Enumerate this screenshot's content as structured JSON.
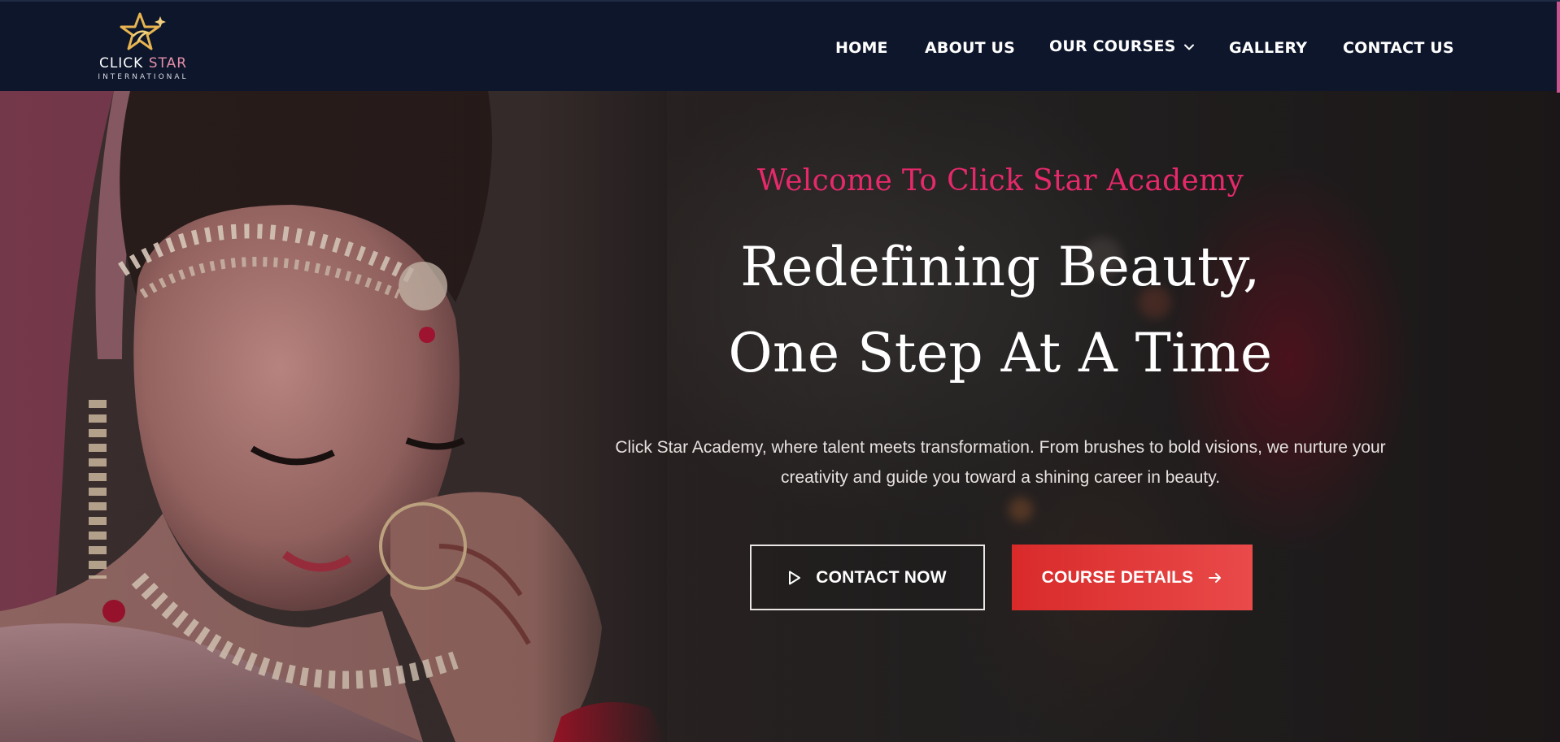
{
  "brand": {
    "name_part1": "CLICK",
    "name_part2": "STAR",
    "subtitle": "INTERNATIONAL",
    "icon": "star-logo-icon",
    "accent_color": "#e58fa9"
  },
  "nav": {
    "items": [
      {
        "label": "HOME"
      },
      {
        "label": "ABOUT US"
      },
      {
        "label": "OUR COURSES",
        "has_dropdown": true,
        "icon": "chevron-down-icon"
      },
      {
        "label": "GALLERY"
      },
      {
        "label": "CONTACT US"
      }
    ]
  },
  "hero": {
    "eyebrow": "Welcome To Click Star Academy",
    "headline_line1": "Redefining Beauty,",
    "headline_line2": "One Step At A Time",
    "description": "Click Star Academy, where talent meets transformation. From brushes to bold visions, we nurture your creativity and guide you toward a shining career in beauty.",
    "primary_button": {
      "label": "CONTACT NOW",
      "icon": "play-icon"
    },
    "secondary_button": {
      "label": "COURSE DETAILS",
      "icon": "arrow-right-icon"
    },
    "image": "bride-portrait-photo",
    "colors": {
      "eyebrow": "#e6296b",
      "cta_red": "#e03434",
      "header_bg": "#0d162b"
    }
  }
}
